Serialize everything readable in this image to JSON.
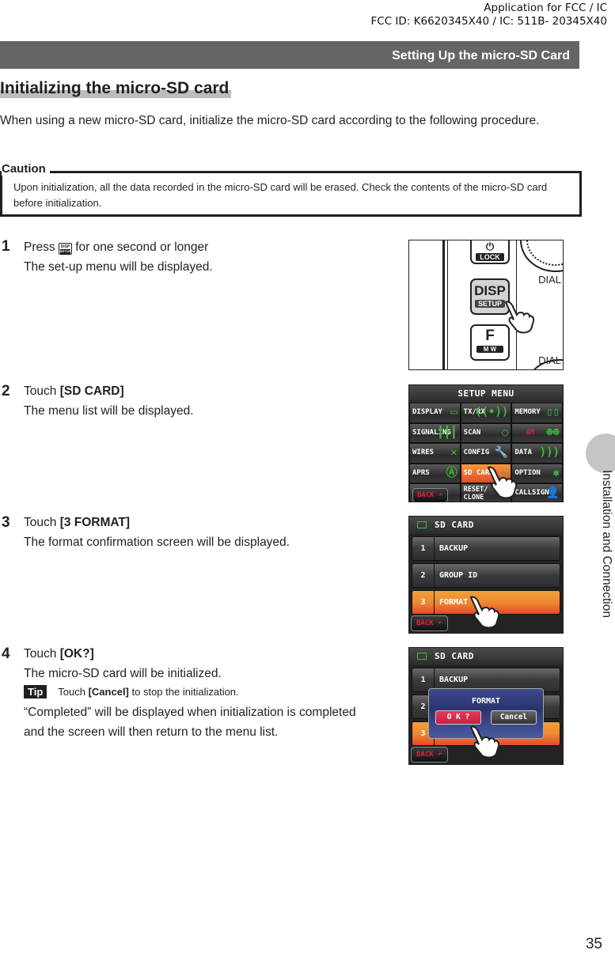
{
  "header": {
    "fcc_line1": "Application for FCC / IC",
    "fcc_line2": "FCC ID: K6620345X40 / IC: 511B- 20345X40",
    "section_title": "Setting Up the micro-SD Card"
  },
  "heading": "Initializing the micro-SD card",
  "intro": "When using a new micro-SD card, initialize the micro-SD card according to the following procedure.",
  "caution": {
    "label": "Caution",
    "text": "Upon initialization, all the data recorded in the micro-SD card will be erased. Check the contents of the micro-SD card before initialization."
  },
  "steps": [
    {
      "number": "1",
      "action_prefix": "Press",
      "key_icon": "disp-setup-key-icon",
      "action_suffix": "for one second or longer",
      "result": "The set-up menu will be displayed."
    },
    {
      "number": "2",
      "action_prefix": "Touch",
      "action_target": "[SD CARD]",
      "result": "The menu list will be displayed."
    },
    {
      "number": "3",
      "action_prefix": "Touch",
      "action_target": "[3 FORMAT]",
      "result": "The format confirmation screen will be displayed."
    },
    {
      "number": "4",
      "action_prefix": "Touch",
      "action_target": "[OK?]",
      "result": "The micro-SD card will be initialized.",
      "tip": {
        "badge": "Tip",
        "prefix": "Touch",
        "target": "[Cancel]",
        "suffix": "to stop the initialization."
      },
      "note": "“Completed” will be displayed when initialization is completed and the screen will then return to the menu list."
    }
  ],
  "figures": {
    "radio": {
      "lock_label": "LOCK",
      "disp_label": "DISP",
      "setup_label": "SETUP",
      "f_label": "F",
      "mw_label": "M W",
      "dial_label_1": "DIAL",
      "dial_label_2": "DIAL"
    },
    "setup_menu": {
      "title": "SETUP MENU",
      "items": [
        {
          "label": "DISPLAY",
          "icon": "monitor-icon",
          "glyph": "▭"
        },
        {
          "label": "TX/RX",
          "icon": "antenna-icon",
          "glyph": "((•))"
        },
        {
          "label": "MEMORY",
          "icon": "book-icon",
          "glyph": "▯▯"
        },
        {
          "label": "SIGNALING",
          "icon": "signal-bars-icon",
          "glyph": "┃┃┃"
        },
        {
          "label": "SCAN",
          "icon": "scan-circle-icon",
          "glyph": "◌"
        },
        {
          "label": "GM",
          "icon": "group-users-icon",
          "glyph": "☻☻"
        },
        {
          "label": "WIRES",
          "icon": "wires-icon",
          "glyph": "✕"
        },
        {
          "label": "CONFIG",
          "icon": "wrench-icon",
          "glyph": "🔧"
        },
        {
          "label": "DATA",
          "icon": "data-waves-icon",
          "glyph": ")))"
        },
        {
          "label": "APRS",
          "icon": "aprs-globe-icon",
          "glyph": "Ⓐ"
        },
        {
          "label": "SD CARD",
          "icon": "folder-icon",
          "glyph": "▭",
          "active": true
        },
        {
          "label": "OPTION",
          "icon": "gears-icon",
          "glyph": "✱"
        },
        {
          "label": "BACK",
          "icon": "back-arrow-icon",
          "glyph": "↶",
          "is_back": true
        },
        {
          "label": "RESET/\nCLONE",
          "icon": "clone-arrows-icon",
          "glyph": "⇄"
        },
        {
          "label": "CALLSIGN",
          "icon": "person-icon",
          "glyph": "👤"
        }
      ]
    },
    "sd_card_menu": {
      "title": "SD CARD",
      "rows": [
        {
          "num": "1",
          "label": "BACKUP"
        },
        {
          "num": "2",
          "label": "GROUP ID"
        },
        {
          "num": "3",
          "label": "FORMAT",
          "active": true
        }
      ],
      "back_label": "BACK"
    },
    "format_dialog": {
      "title": "SD CARD",
      "rows": [
        {
          "num": "1",
          "label": "BACKUP"
        },
        {
          "num": "2",
          "label": ""
        },
        {
          "num": "3",
          "label": "",
          "active": true
        }
      ],
      "dialog_title": "FORMAT",
      "ok_label": "O K ?",
      "cancel_label": "Cancel",
      "back_label": "BACK"
    }
  },
  "side_tab": "Installation and Connection",
  "page_number": "35"
}
